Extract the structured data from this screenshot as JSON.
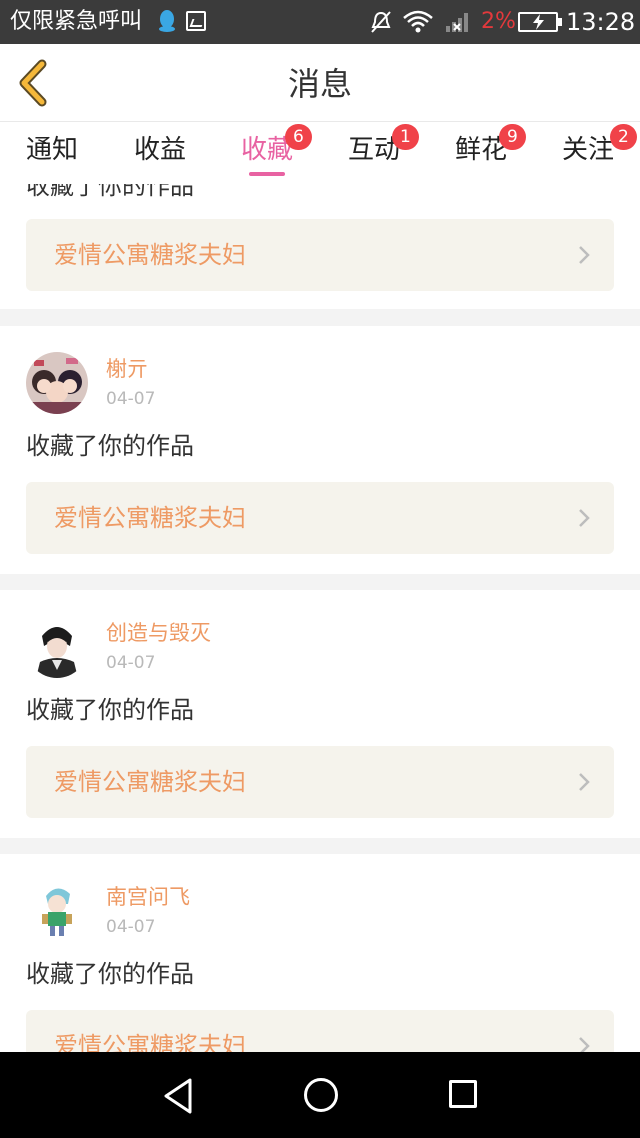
{
  "status_bar": {
    "notification_title": "仅限紧急呼叫",
    "battery_percent": "2%",
    "time": "13:28",
    "icons": [
      "qq-icon",
      "image-icon",
      "mute-icon",
      "wifi-icon",
      "signal-icon",
      "battery-charging-icon"
    ]
  },
  "header": {
    "title": "消息",
    "back_icon": "chevron-left-icon",
    "back_color": "#f5b83a"
  },
  "tabs": [
    {
      "label": "通知",
      "badge": ""
    },
    {
      "label": "收益",
      "badge": ""
    },
    {
      "label": "收藏",
      "badge": "6",
      "active": true
    },
    {
      "label": "互动",
      "badge": "1"
    },
    {
      "label": "鲜花",
      "badge": "9"
    },
    {
      "label": "关注",
      "badge": "2"
    }
  ],
  "feed": {
    "partial_item": {
      "action": "收藏了你的作品",
      "work_title": "爱情公寓糖浆夫妇"
    },
    "items": [
      {
        "username": "榭亓",
        "date": "04-07",
        "action": "收藏了你的作品",
        "work_title": "爱情公寓糖浆夫妇",
        "avatar": "anime-group-avatar"
      },
      {
        "username": "创造与毁灭",
        "date": "04-07",
        "action": "收藏了你的作品",
        "work_title": "爱情公寓糖浆夫妇",
        "avatar": "dark-hair-character-avatar"
      },
      {
        "username": "南宫问飞",
        "date": "04-07",
        "action": "收藏了你的作品",
        "work_title": "爱情公寓糖浆夫妇",
        "avatar": "chibi-character-avatar"
      }
    ]
  },
  "colors": {
    "accent_pink": "#e862a2",
    "badge_red": "#f04249",
    "username_orange": "#ee9a64",
    "work_bg": "#f5f3ec"
  },
  "nav_bar": {
    "icons": [
      "back-triangle-icon",
      "home-circle-icon",
      "recent-square-icon"
    ]
  }
}
